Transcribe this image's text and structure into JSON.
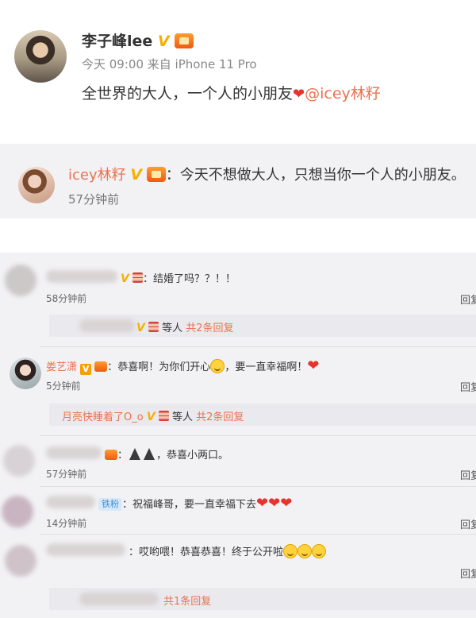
{
  "post": {
    "author": "李子峰lee",
    "time": "今天 09:00",
    "source": "来自 iPhone 11 Pro",
    "text": "全世界的大人，一个人的小朋友",
    "mention": "@icey林籽"
  },
  "repost": {
    "author": "icey林籽",
    "text": "：今天不想做大人，只想当你一个人的小朋友。",
    "time": "57分钟前"
  },
  "comments": [
    {
      "text": "：结婚了吗？？！！",
      "time": "58分钟前",
      "reply": "回复",
      "sub": {
        "prefix": "等人",
        "count": "共2条回复"
      }
    },
    {
      "name": "娄艺潇",
      "text_a": "：恭喜啊！为你们开心",
      "text_b": "，要一直幸福啊！",
      "time": "5分钟前",
      "reply": "回复",
      "sub": {
        "name": "月亮快睡着了O_o",
        "prefix": "等人",
        "count": "共2条回复"
      }
    },
    {
      "text": "，恭喜小两口。",
      "time": "57分钟前",
      "reply": "回复"
    },
    {
      "badge": "铁粉",
      "text": "祝福峰哥，要一直幸福下去",
      "time": "14分钟前",
      "reply": "回复"
    },
    {
      "text": "哎哟喂！恭喜恭喜！终于公开啦",
      "reply": "回复",
      "sub": {
        "count": "共1条回复"
      }
    }
  ],
  "colors": {
    "accent": "#eb7350",
    "vip": "#f5b000",
    "panel": "#f2f2f5"
  }
}
